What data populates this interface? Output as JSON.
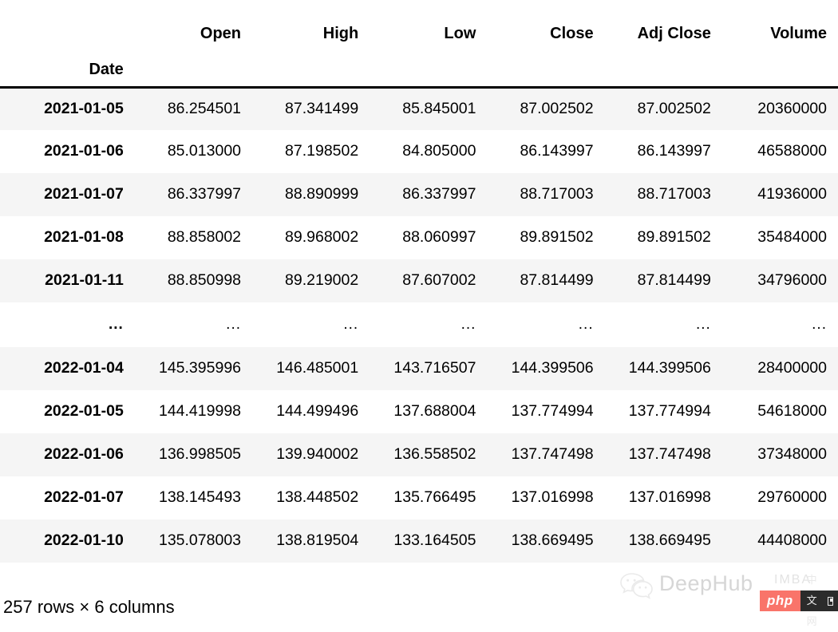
{
  "table": {
    "index_name": "Date",
    "columns": [
      "Open",
      "High",
      "Low",
      "Close",
      "Adj Close",
      "Volume"
    ],
    "ellipsis": "...",
    "rows": [
      {
        "date": "2021-01-05",
        "values": [
          "86.254501",
          "87.341499",
          "85.845001",
          "87.002502",
          "87.002502",
          "20360000"
        ]
      },
      {
        "date": "2021-01-06",
        "values": [
          "85.013000",
          "87.198502",
          "84.805000",
          "86.143997",
          "86.143997",
          "46588000"
        ]
      },
      {
        "date": "2021-01-07",
        "values": [
          "86.337997",
          "88.890999",
          "86.337997",
          "88.717003",
          "88.717003",
          "41936000"
        ]
      },
      {
        "date": "2021-01-08",
        "values": [
          "88.858002",
          "89.968002",
          "88.060997",
          "89.891502",
          "89.891502",
          "35484000"
        ]
      },
      {
        "date": "2021-01-11",
        "values": [
          "88.850998",
          "89.219002",
          "87.607002",
          "87.814499",
          "87.814499",
          "34796000"
        ]
      },
      {
        "date": "...",
        "values": [
          "...",
          "...",
          "...",
          "...",
          "...",
          "..."
        ],
        "is_ellipsis": true
      },
      {
        "date": "2022-01-04",
        "values": [
          "145.395996",
          "146.485001",
          "143.716507",
          "144.399506",
          "144.399506",
          "28400000"
        ]
      },
      {
        "date": "2022-01-05",
        "values": [
          "144.419998",
          "144.499496",
          "137.688004",
          "137.774994",
          "137.774994",
          "54618000"
        ]
      },
      {
        "date": "2022-01-06",
        "values": [
          "136.998505",
          "139.940002",
          "136.558502",
          "137.747498",
          "137.747498",
          "37348000"
        ]
      },
      {
        "date": "2022-01-07",
        "values": [
          "138.145493",
          "138.448502",
          "135.766495",
          "137.016998",
          "137.016998",
          "29760000"
        ]
      },
      {
        "date": "2022-01-10",
        "values": [
          "135.078003",
          "138.819504",
          "133.164505",
          "138.669495",
          "138.669495",
          "44408000"
        ]
      }
    ],
    "shape_text": "257 rows × 6 columns"
  },
  "watermark": {
    "logo_icon": "wechat-icon",
    "title": "DeepHub",
    "subtitle": "IMBA",
    "badge_left": "php",
    "badge_right": "中文网",
    "badge_icon": "qr-code-icon",
    "badge_color": "#f9746a"
  }
}
